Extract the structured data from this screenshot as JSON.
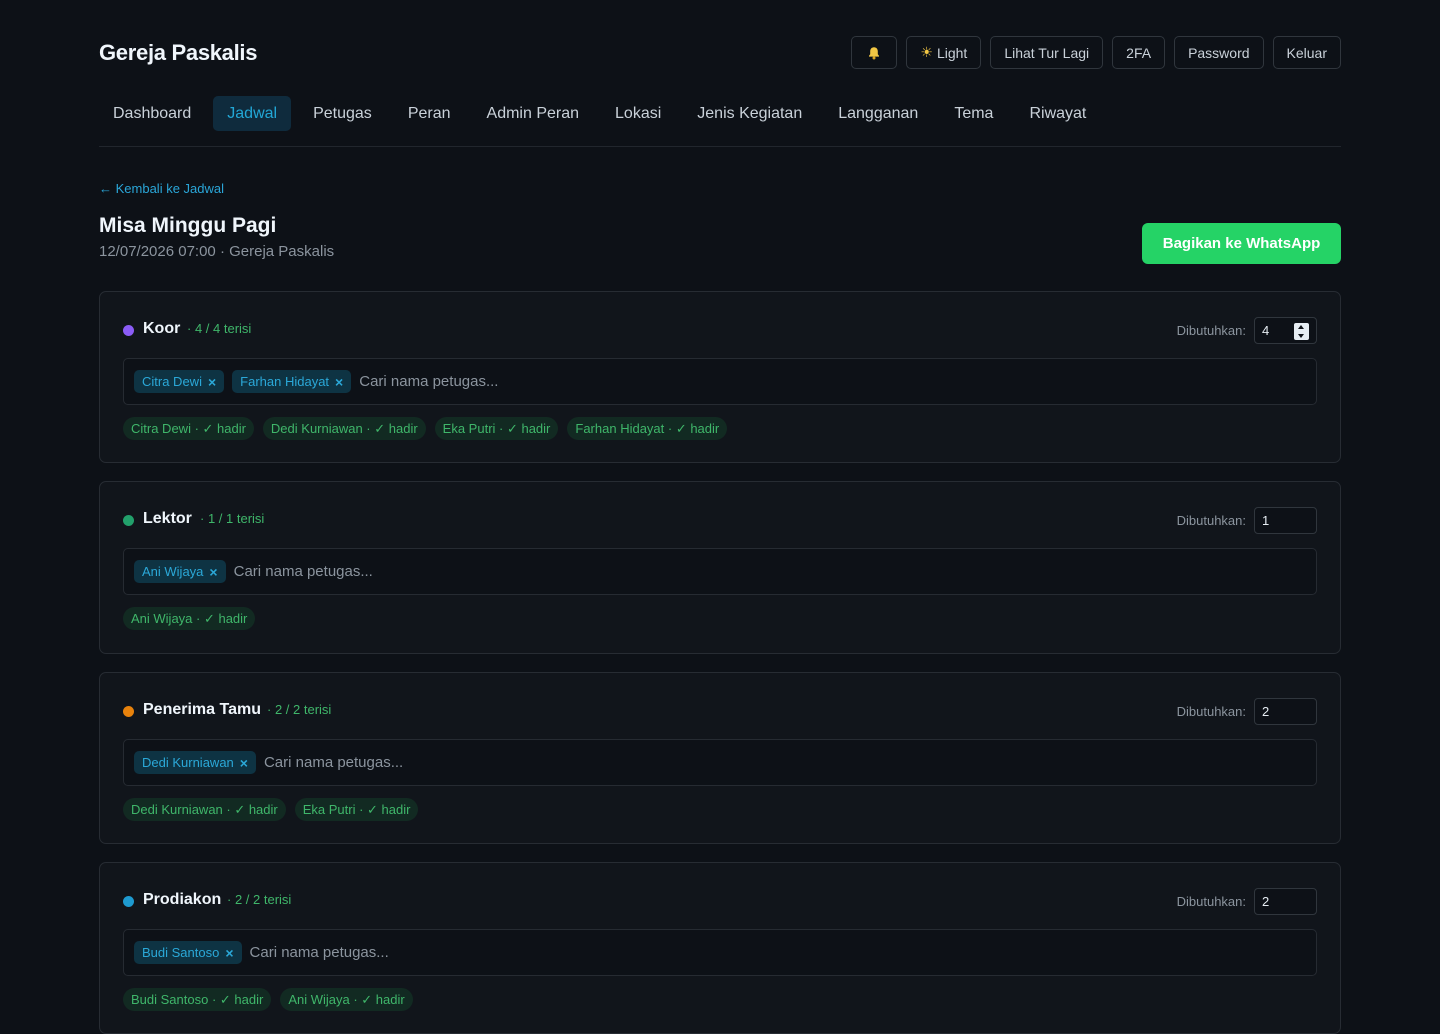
{
  "app": {
    "name": "Gereja Paskalis"
  },
  "header": {
    "bell_icon": "bell-icon",
    "theme_label": "Light",
    "tour_label": "Lihat Tur Lagi",
    "twofa_label": "2FA",
    "password_label": "Password",
    "logout_label": "Keluar"
  },
  "nav": {
    "items": [
      "Dashboard",
      "Jadwal",
      "Petugas",
      "Peran",
      "Admin Peran",
      "Lokasi",
      "Jenis Kegiatan",
      "Langganan",
      "Tema",
      "Riwayat"
    ],
    "active": "Jadwal"
  },
  "page": {
    "back_label": "← Kembali ke Jadwal",
    "title": "Misa Minggu Pagi",
    "subtitle": "12/07/2026 07:00 · Gereja Paskalis",
    "share_label": "Bagikan ke WhatsApp"
  },
  "colors": {
    "accent": "#22a7d6",
    "whatsapp": "#25d366",
    "success": "#3fb66a"
  },
  "roles": [
    {
      "name": "Koor",
      "fill_text": "· 4 / 4 terisi",
      "dot_color": "#8b5cf6",
      "needed_label": "Dibutuhkan:",
      "needed": "4",
      "chips": [
        "Citra Dewi",
        "Farhan Hidayat"
      ],
      "placeholder": "Cari nama petugas...",
      "attendance": [
        "Citra Dewi · ✓ hadir",
        "Dedi Kurniawan · ✓ hadir",
        "Eka Putri · ✓ hadir",
        "Farhan Hidayat · ✓ hadir"
      ]
    },
    {
      "name": "Lektor",
      "fill_text": "· 1 / 1 terisi",
      "dot_color": "#22a06b",
      "needed_label": "Dibutuhkan:",
      "needed": "1",
      "chips": [
        "Ani Wijaya"
      ],
      "placeholder": "Cari nama petugas...",
      "attendance": [
        "Ani Wijaya · ✓ hadir"
      ]
    },
    {
      "name": "Penerima Tamu",
      "fill_text": "· 2 / 2 terisi",
      "dot_color": "#e8820c",
      "needed_label": "Dibutuhkan:",
      "needed": "2",
      "chips": [
        "Dedi Kurniawan"
      ],
      "placeholder": "Cari nama petugas...",
      "attendance": [
        "Dedi Kurniawan · ✓ hadir",
        "Eka Putri · ✓ hadir"
      ]
    },
    {
      "name": "Prodiakon",
      "fill_text": "· 2 / 2 terisi",
      "dot_color": "#1e9ad0",
      "needed_label": "Dibutuhkan:",
      "needed": "2",
      "chips": [
        "Budi Santoso"
      ],
      "placeholder": "Cari nama petugas...",
      "attendance": [
        "Budi Santoso · ✓ hadir",
        "Ani Wijaya · ✓ hadir"
      ]
    }
  ]
}
